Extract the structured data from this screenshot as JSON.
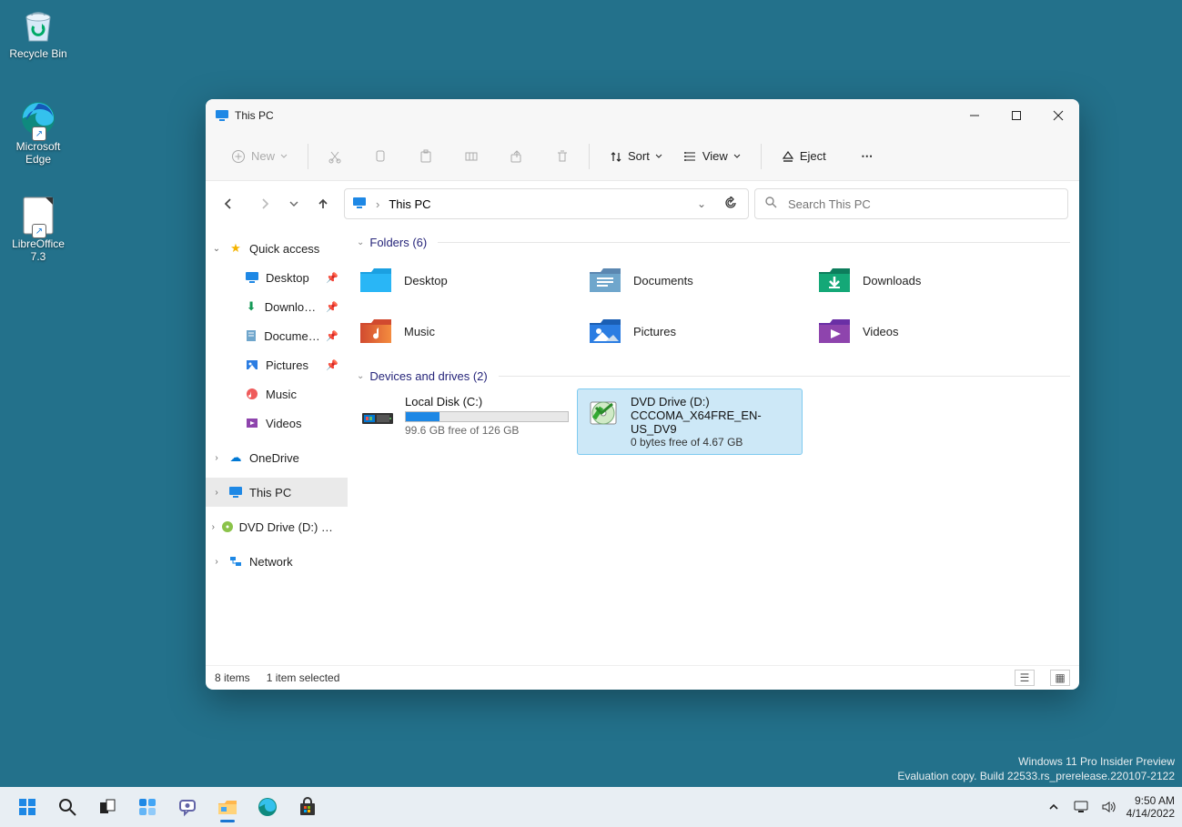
{
  "desktop": {
    "icons": [
      {
        "name": "Recycle Bin"
      },
      {
        "name": "Microsoft Edge"
      },
      {
        "name": "LibreOffice 7.3"
      }
    ]
  },
  "watermark": {
    "line1": "Windows 11 Pro Insider Preview",
    "line2": "Evaluation copy. Build 22533.rs_prerelease.220107-2122"
  },
  "explorer": {
    "title": "This PC",
    "toolbar": {
      "new": "New",
      "sort": "Sort",
      "view": "View",
      "eject": "Eject",
      "more": "⋯"
    },
    "address": {
      "location": "This PC"
    },
    "search": {
      "placeholder": "Search This PC"
    },
    "nav": {
      "quick_access": "Quick access",
      "desktop": "Desktop",
      "downloads": "Downloads",
      "documents": "Documents",
      "pictures": "Pictures",
      "music": "Music",
      "videos": "Videos",
      "onedrive": "OneDrive",
      "this_pc": "This PC",
      "dvd": "DVD Drive (D:) CCCOMA_X64FRE_EN-US_DV9",
      "network": "Network"
    },
    "folders": {
      "header": "Folders (6)",
      "items": [
        "Desktop",
        "Documents",
        "Downloads",
        "Music",
        "Pictures",
        "Videos"
      ]
    },
    "drives": {
      "header": "Devices and drives (2)",
      "local": {
        "name": "Local Disk (C:)",
        "sub": "99.6 GB free of 126 GB",
        "fill_pct": 21
      },
      "dvd": {
        "name": "DVD Drive (D:)",
        "label": "CCCOMA_X64FRE_EN-US_DV9",
        "sub": "0 bytes free of 4.67 GB"
      }
    },
    "status": {
      "items": "8 items",
      "selected": "1 item selected"
    }
  },
  "taskbar": {
    "time": "9:50 AM",
    "date": "4/14/2022"
  }
}
